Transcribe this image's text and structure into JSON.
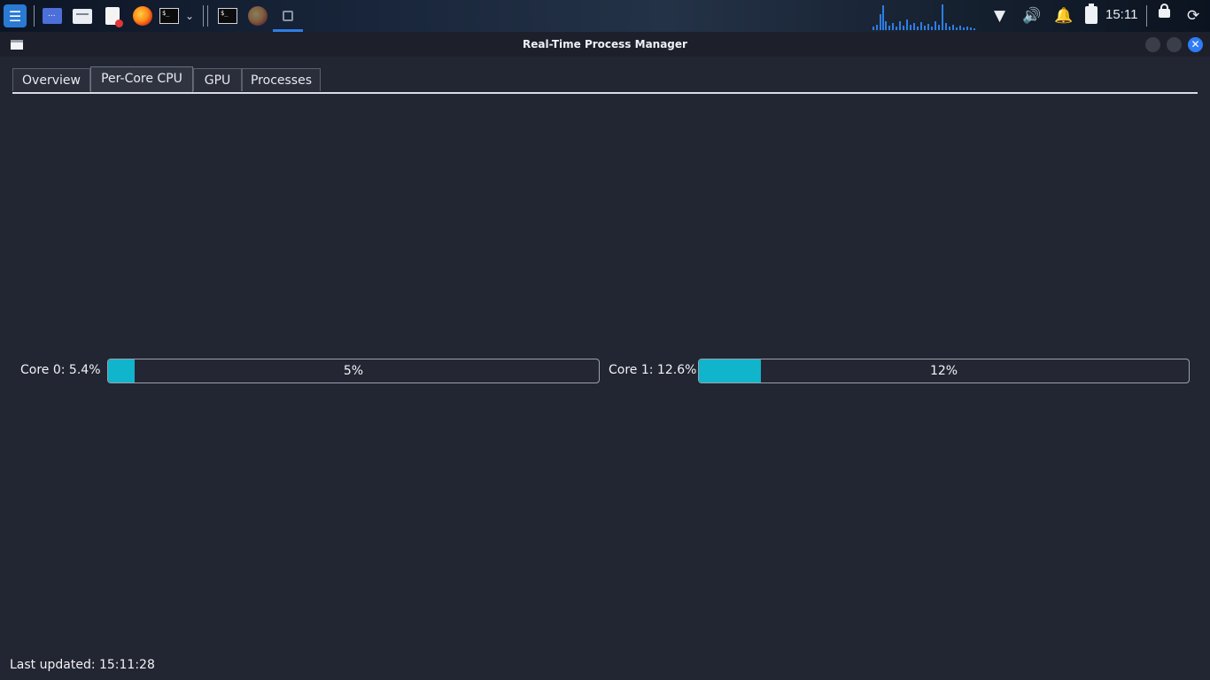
{
  "taskbar": {
    "launchers": [
      {
        "icon": "kali-menu-icon"
      },
      {
        "icon": "workspace-icon"
      },
      {
        "icon": "file-manager-icon"
      },
      {
        "icon": "text-editor-icon"
      },
      {
        "icon": "firefox-icon"
      },
      {
        "icon": "terminal-icon"
      },
      {
        "icon": "chevron-down-icon"
      }
    ],
    "open_windows": [
      {
        "icon": "terminal-icon"
      },
      {
        "icon": "firefox-icon"
      },
      {
        "icon": "app-window-icon",
        "active": true
      }
    ],
    "tray": {
      "clock": "15:11"
    },
    "accent_color": "#2f7de3"
  },
  "window": {
    "title": "Real-Time Process Manager",
    "tabs": [
      {
        "label": "Overview",
        "active": false
      },
      {
        "label": "Per-Core CPU",
        "active": true
      },
      {
        "label": "GPU",
        "active": false
      },
      {
        "label": "Processes",
        "active": false
      }
    ],
    "cores": [
      {
        "label": "Core 0: 5.4%",
        "percent": 5.4,
        "bar_text": "5%"
      },
      {
        "label": "Core 1: 12.6%",
        "percent": 12.6,
        "bar_text": "12%"
      }
    ],
    "status": "Last updated: 15:11:28",
    "bar_color": "#10b5cc",
    "background_color": "#222532"
  }
}
